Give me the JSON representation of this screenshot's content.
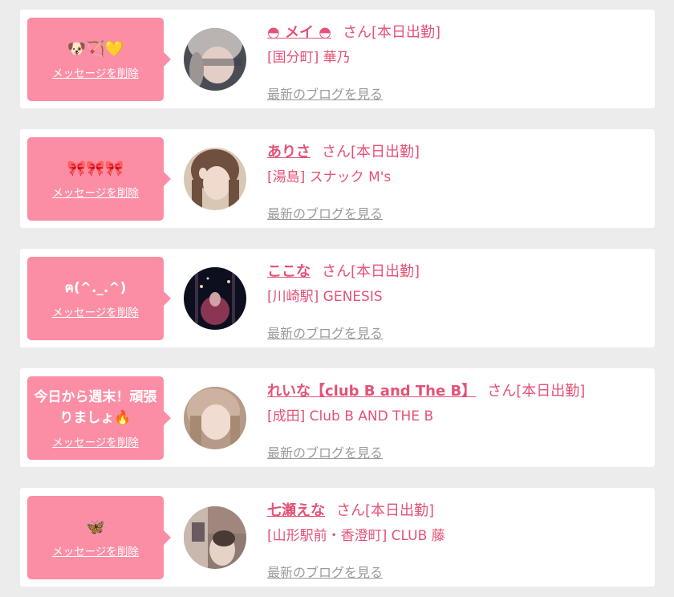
{
  "common": {
    "delete_label": "メッセージを削除",
    "honorific": "さん",
    "status": "[本日出勤]",
    "blog_label": "最新のブログを見る"
  },
  "colors": {
    "background": "#ececec",
    "card": "#ffffff",
    "bubble": "#fb8ea5",
    "accent_text": "#e45277",
    "muted_link": "#9a9a9a"
  },
  "entries": [
    {
      "message": "🐶🏹💛",
      "message_is_emoji": true,
      "cast_name": "◓ メイ ◓",
      "shop": "[国分町] 華乃"
    },
    {
      "message": "🎀🎀🎀",
      "message_is_emoji": true,
      "cast_name": "ありさ",
      "shop": "[湯島] スナック M's"
    },
    {
      "message": "ฅ(^._.^)",
      "message_is_emoji": false,
      "cast_name": "ここな",
      "shop": "[川崎駅] GENESIS"
    },
    {
      "message": "今日から週末！頑張りましょ🔥",
      "message_is_emoji": false,
      "cast_name": "れいな【club B and The B】",
      "shop": "[成田] Club B AND THE B"
    },
    {
      "message": "🦋",
      "message_is_emoji": true,
      "cast_name": "七瀬えな",
      "shop": "[山形駅前・香澄町] CLUB 藤"
    }
  ]
}
